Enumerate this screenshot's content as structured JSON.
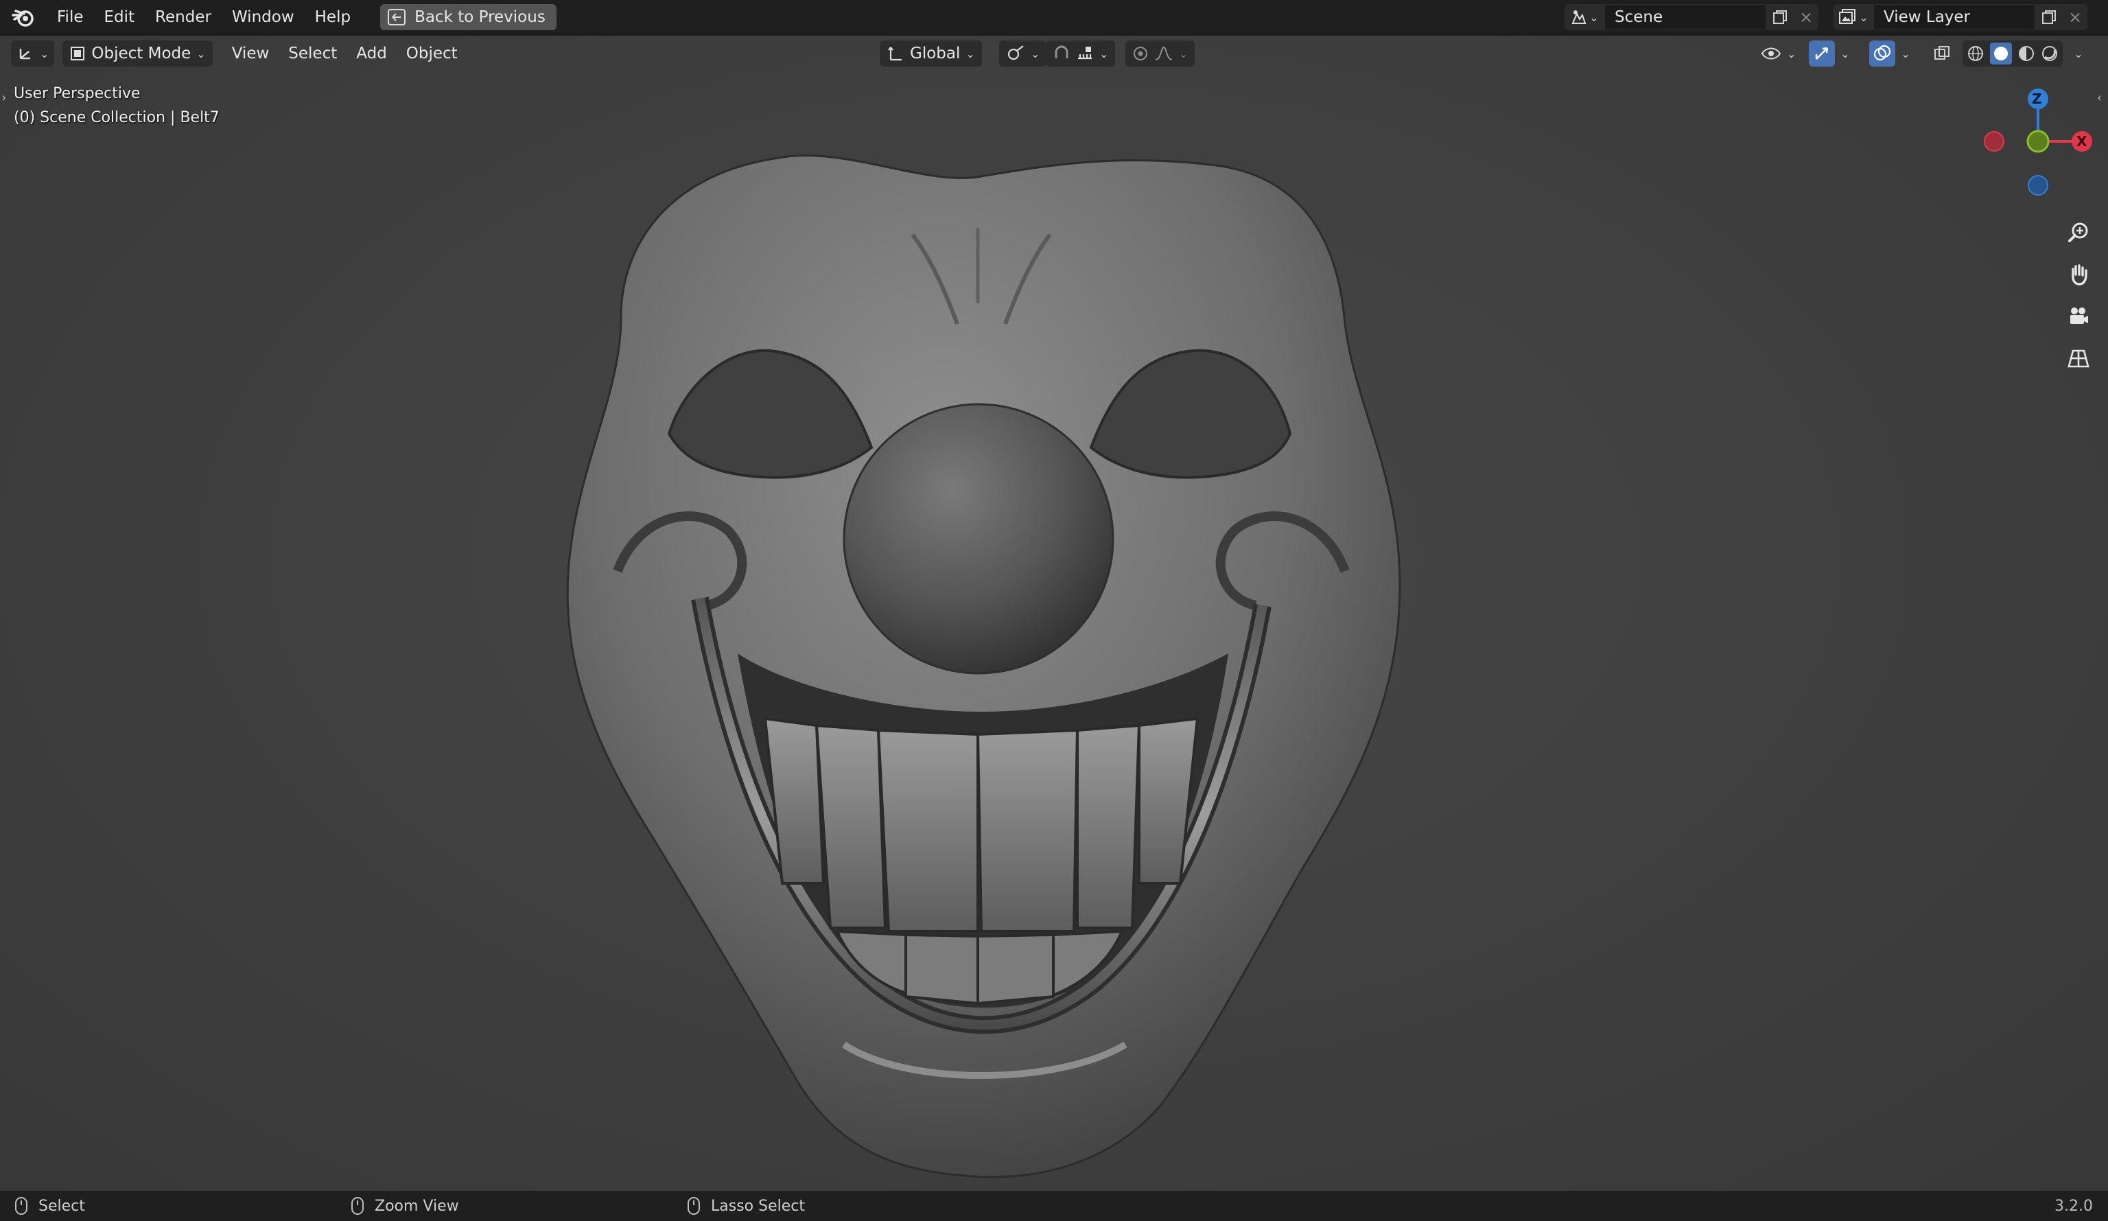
{
  "topbar": {
    "menus": [
      "File",
      "Edit",
      "Render",
      "Window",
      "Help"
    ],
    "back_button": "Back to Previous",
    "scene_name": "Scene",
    "view_layer_name": "View Layer"
  },
  "viewport_header": {
    "mode": "Object Mode",
    "menus": [
      "View",
      "Select",
      "Add",
      "Object"
    ],
    "transform_orientation": "Global"
  },
  "viewport": {
    "perspective_label": "User Perspective",
    "collection_label": "(0) Scene Collection | Belt7",
    "gizmo": {
      "z_label": "Z",
      "x_label": "X"
    }
  },
  "statusbar": {
    "left_click": "Select",
    "middle_click": "Zoom View",
    "right_click": "Lasso Select",
    "version": "3.2.0"
  },
  "colors": {
    "axis_x": "#e0384a",
    "axis_y": "#8bbe2a",
    "axis_z": "#2f7fd6",
    "active_blue": "#4772b3"
  }
}
